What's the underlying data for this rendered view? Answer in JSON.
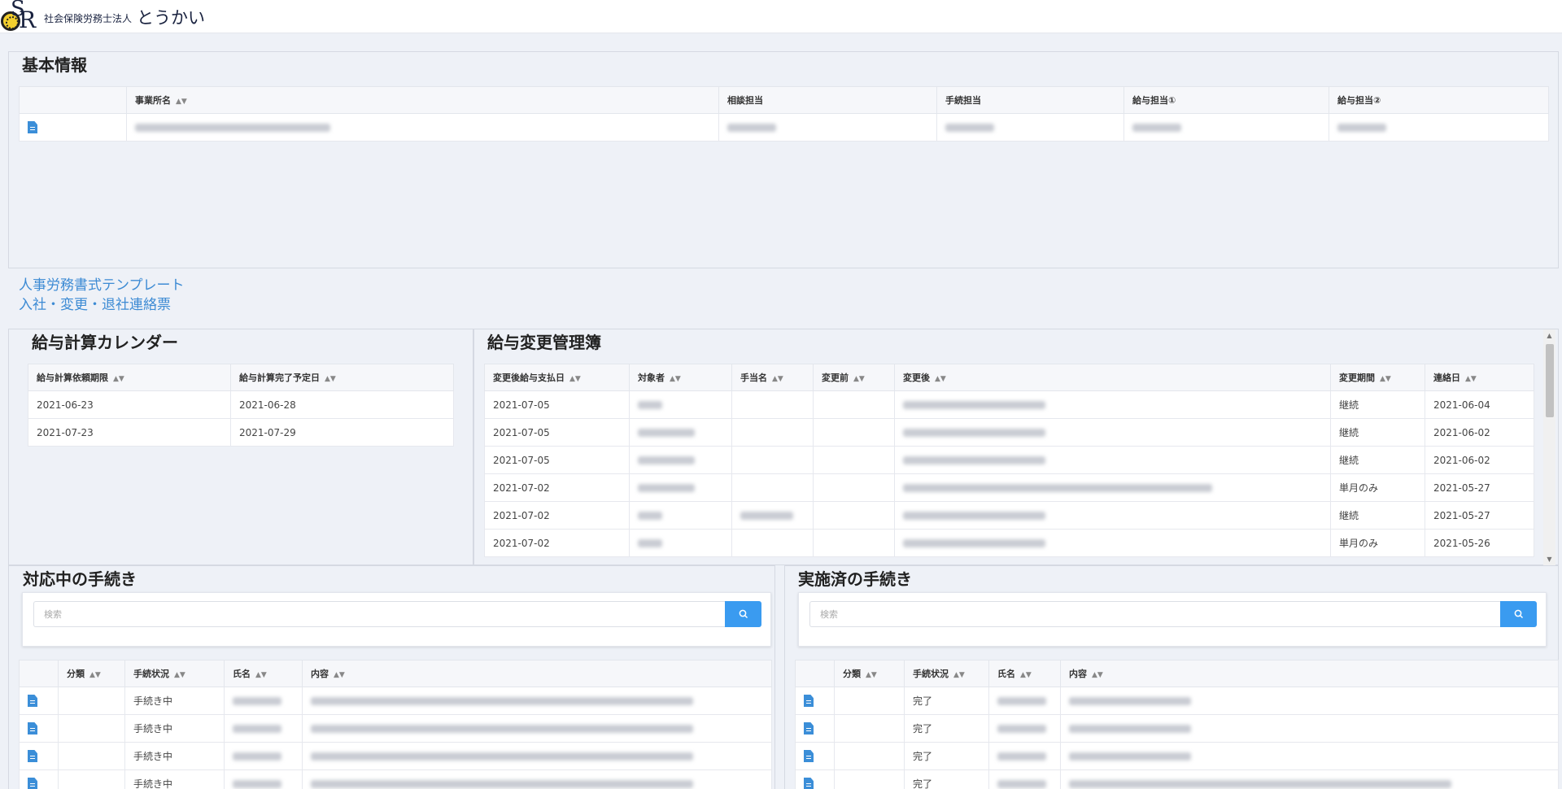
{
  "header": {
    "logo_small": "社会保険労務士法人",
    "logo_big": "とうかい"
  },
  "basic": {
    "title": "基本情報",
    "columns": [
      "",
      "事業所名",
      "相談担当",
      "手続担当",
      "給与担当①",
      "給与担当②"
    ]
  },
  "links": {
    "template": "人事労務書式テンプレート",
    "contact": "入社・変更・退社連絡票"
  },
  "calendar": {
    "title": "給与計算カレンダー",
    "columns": [
      "給与計算依頼期限",
      "給与計算完了予定日"
    ],
    "rows": [
      [
        "2021-06-23",
        "2021-06-28"
      ],
      [
        "2021-07-23",
        "2021-07-29"
      ]
    ]
  },
  "salary_change": {
    "title": "給与変更管理簿",
    "columns": [
      "変更後給与支払日",
      "対象者",
      "手当名",
      "変更前",
      "変更後",
      "変更期間",
      "連絡日"
    ],
    "rows": [
      {
        "date": "2021-07-05",
        "period": "継続",
        "contact": "2021-06-04"
      },
      {
        "date": "2021-07-05",
        "period": "継続",
        "contact": "2021-06-02"
      },
      {
        "date": "2021-07-05",
        "period": "継続",
        "contact": "2021-06-02"
      },
      {
        "date": "2021-07-02",
        "period": "単月のみ",
        "contact": "2021-05-27"
      },
      {
        "date": "2021-07-02",
        "period": "継続",
        "contact": "2021-05-27"
      },
      {
        "date": "2021-07-02",
        "period": "単月のみ",
        "contact": "2021-05-26"
      }
    ]
  },
  "inprogress": {
    "title": "対応中の手続き",
    "search_placeholder": "検索",
    "columns": [
      "",
      "分類",
      "手続状況",
      "氏名",
      "内容"
    ],
    "rows": [
      {
        "status": "手続き中"
      },
      {
        "status": "手続き中"
      },
      {
        "status": "手続き中"
      },
      {
        "status": "手続き中"
      }
    ]
  },
  "completed": {
    "title": "実施済の手続き",
    "search_placeholder": "検索",
    "columns": [
      "",
      "分類",
      "手続状況",
      "氏名",
      "内容"
    ],
    "rows": [
      {
        "status": "完了"
      },
      {
        "status": "完了"
      },
      {
        "status": "完了"
      },
      {
        "status": "完了"
      }
    ]
  },
  "colors": {
    "accent": "#3a9bf0",
    "link": "#3d8bd4",
    "doc_icon": "#3b8ed8"
  },
  "icons": [
    "document-icon",
    "search-icon",
    "sort-icon"
  ]
}
